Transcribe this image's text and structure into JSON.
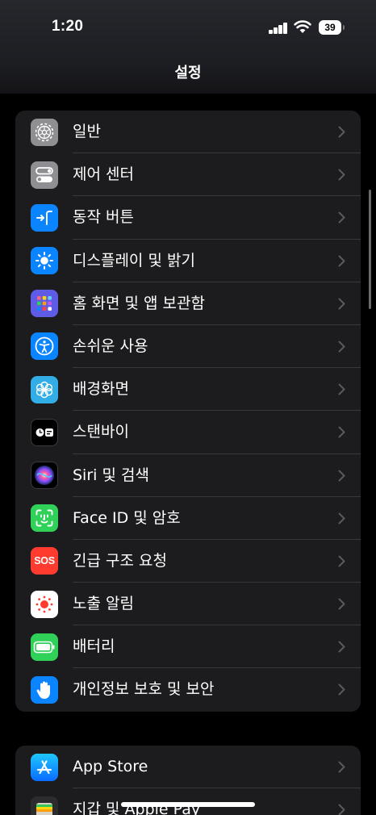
{
  "status": {
    "time": "1:20",
    "battery": "39"
  },
  "title": "설정",
  "groups": [
    {
      "items": [
        {
          "label": "일반",
          "icon": "gear-icon",
          "color": "#8e8e93"
        },
        {
          "label": "제어 센터",
          "icon": "toggle-icon",
          "color": "#8e8e93"
        },
        {
          "label": "동작 버튼",
          "icon": "action-button-icon",
          "color": "#0a84ff"
        },
        {
          "label": "디스플레이 및 밝기",
          "icon": "sun-icon",
          "color": "#0a84ff"
        },
        {
          "label": "홈 화면 및 앱 보관함",
          "icon": "app-grid-icon",
          "color": "#5e5ce6"
        },
        {
          "label": "손쉬운 사용",
          "icon": "accessibility-icon",
          "color": "#0a84ff"
        },
        {
          "label": "배경화면",
          "icon": "flower-icon",
          "color": "#32ade6"
        },
        {
          "label": "스탠바이",
          "icon": "standby-icon",
          "color": "#000000"
        },
        {
          "label": "Siri 및 검색",
          "icon": "siri-icon",
          "color": "#000000"
        },
        {
          "label": "Face ID 및 암호",
          "icon": "face-id-icon",
          "color": "#30d158"
        },
        {
          "label": "긴급 구조 요청",
          "icon": "sos-icon",
          "color": "#ff3b30",
          "text": "SOS"
        },
        {
          "label": "노출 알림",
          "icon": "exposure-icon",
          "color": "#ffffff"
        },
        {
          "label": "배터리",
          "icon": "battery-icon",
          "color": "#30d158"
        },
        {
          "label": "개인정보 보호 및 보안",
          "icon": "hand-icon",
          "color": "#0a84ff"
        }
      ]
    },
    {
      "items": [
        {
          "label": "App Store",
          "icon": "app-store-icon",
          "color": "#0a84ff"
        },
        {
          "label": "지갑 및 Apple Pay",
          "icon": "wallet-icon",
          "color": "#3a3a3c"
        }
      ]
    }
  ]
}
